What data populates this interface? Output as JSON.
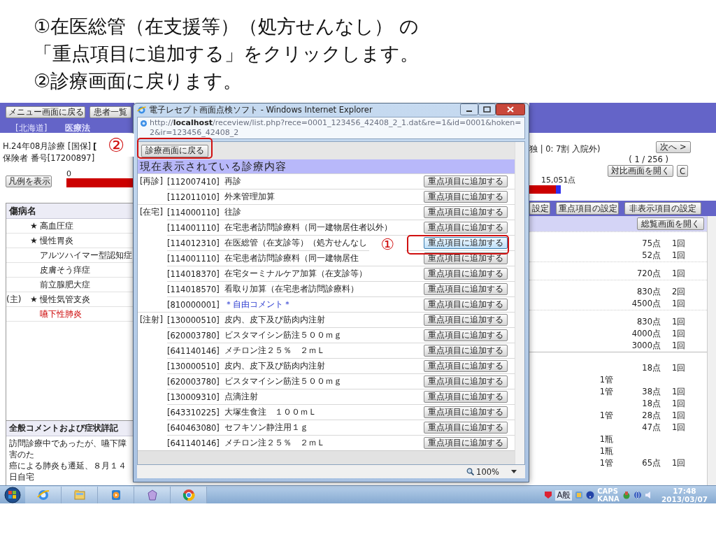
{
  "slide": {
    "instructions": [
      "①在医総管（在支援等）（処方せんなし） の",
      "「重点項目に追加する」をクリックします。",
      "②診療画面に戻ります。"
    ]
  },
  "main_app": {
    "nav_buttons": [
      "メニュー画面に戻る",
      "患者一覧"
    ],
    "prefecture": "[北海道]",
    "facility": "医療法",
    "claim_line": "H.24年08月診療 [国保]",
    "bracket": "[",
    "insurer": "保険者 番号[17200897]",
    "legend_button": "凡例を表示",
    "bar_min": "0",
    "insurance_type": "独 | 0: 7割 入院外)",
    "next_button": "次へ >",
    "page": "( 1 / 256 )",
    "compare_button": "対比画面を開く",
    "c_button": "C",
    "bar_total": "15,051点",
    "setting_tabs": [
      "設定",
      "重点項目の設定",
      "非表示項目の設定"
    ],
    "overview_button": "総覧画面を開く",
    "diseases": {
      "header": "傷病名",
      "items": [
        {
          "mark": "★",
          "name": "高血圧症",
          "kind": "normal"
        },
        {
          "mark": "★",
          "name": "慢性胃炎",
          "kind": "normal"
        },
        {
          "name": "アルツハイマー型認知症",
          "kind": "normal"
        },
        {
          "name": "皮膚そう痒症",
          "kind": "normal"
        },
        {
          "name": "前立腺肥大症",
          "kind": "normal"
        },
        {
          "prefix": "(主)",
          "mark": "★",
          "name": "慢性気管支炎",
          "kind": "normal"
        },
        {
          "name": "嚥下性肺炎",
          "kind": "alert"
        }
      ]
    },
    "points_groups": [
      [
        {
          "points": "75点",
          "count": "1回"
        },
        {
          "points": "52点",
          "count": "1回"
        }
      ],
      [
        {
          "points": "720点",
          "count": "1回"
        }
      ],
      [
        {
          "points": "830点",
          "count": "2回"
        },
        {
          "points": "4500点",
          "count": "1回"
        }
      ],
      [
        {
          "points": "830点",
          "count": "1回"
        },
        {
          "points": "4000点",
          "count": "1回"
        },
        {
          "points": "3000点",
          "count": "1回"
        }
      ],
      [
        {
          "points": "18点",
          "count": "1回"
        },
        {
          "unit": "1管"
        },
        {
          "unit": "1管",
          "points": "38点",
          "count": "1回"
        },
        {
          "points": "18点",
          "count": "1回"
        },
        {
          "unit": "1管",
          "points": "28点",
          "count": "1回"
        },
        {
          "points": "47点",
          "count": "1回"
        },
        {
          "unit": "1瓶"
        },
        {
          "unit": "1瓶"
        },
        {
          "unit": "1管",
          "points": "65点",
          "count": "1回"
        }
      ]
    ],
    "comment": {
      "header": "全般コメントおよび症状詳記",
      "lines": [
        "訪問診療中であったが、嚥下障害のた",
        "癌による肺炎も遷延、８月１４日自宅"
      ]
    }
  },
  "browser": {
    "title": "電子レセプト画面点検ソフト - Windows Internet Explorer",
    "url": "http://**localhost**/receview/list.php?rece=0001_123456_42408_2_1.dat&re=1&id=0001&hoken=2&ir=123456_42408_2",
    "back_button": "診療画面に戻る",
    "section_title": "現在表示されている診療内容",
    "rows": [
      {
        "category": "[再診]",
        "code": "[112007410]",
        "name": "再診",
        "kind": "item",
        "button": "重点項目に追加する",
        "highlighted": false
      },
      {
        "code": "[112011010]",
        "name": "外来管理加算",
        "kind": "item",
        "button": "重点項目に追加する",
        "highlighted": false
      },
      {
        "category": "[在宅]",
        "code": "[114000110]",
        "name": "往診",
        "kind": "item",
        "button": "重点項目に追加する",
        "highlighted": false
      },
      {
        "code": "[114001110]",
        "name": "在宅患者訪問診療料（同一建物居住者以外）",
        "kind": "item",
        "button": "重点項目に追加する",
        "highlighted": false
      },
      {
        "code": "[114012310]",
        "name": "在医総管（在支診等）（処方せんなし",
        "kind": "item",
        "button": "重点項目に追加する",
        "highlighted": true
      },
      {
        "code": "[114001110]",
        "name": "在宅患者訪問診療料（同一建物居住",
        "kind": "item",
        "button": "重点項目に追加する",
        "highlighted": false
      },
      {
        "code": "[114018370]",
        "name": "在宅ターミナルケア加算（在支診等）",
        "kind": "item",
        "button": "重点項目に追加する",
        "highlighted": false
      },
      {
        "code": "[114018570]",
        "name": "看取り加算（在宅患者訪問診療料）",
        "kind": "item",
        "button": "重点項目に追加する",
        "highlighted": false
      },
      {
        "code": "[810000001]",
        "name": "＊自由コメント＊",
        "kind": "comment",
        "button": "重点項目に追加する",
        "highlighted": false
      },
      {
        "category": "[注射]",
        "code": "[130000510]",
        "name": "皮内、皮下及び筋肉内注射",
        "kind": "item",
        "button": "重点項目に追加する",
        "highlighted": false
      },
      {
        "code": "[620003780]",
        "name": "ビスタマイシン筋注５００ｍｇ",
        "kind": "item",
        "button": "重点項目に追加する",
        "highlighted": false
      },
      {
        "code": "[641140146]",
        "name": "メチロン注２５％　２ｍＬ",
        "kind": "item",
        "button": "重点項目に追加する",
        "highlighted": false
      },
      {
        "code": "[130000510]",
        "name": "皮内、皮下及び筋肉内注射",
        "kind": "item",
        "button": "重点項目に追加する",
        "highlighted": false
      },
      {
        "code": "[620003780]",
        "name": "ビスタマイシン筋注５００ｍｇ",
        "kind": "item",
        "button": "重点項目に追加する",
        "highlighted": false
      },
      {
        "code": "[130009310]",
        "name": "点滴注射",
        "kind": "item",
        "button": "重点項目に追加する",
        "highlighted": false
      },
      {
        "code": "[643310225]",
        "name": "大塚生食注　１００ｍＬ",
        "kind": "item",
        "button": "重点項目に追加する",
        "highlighted": false
      },
      {
        "code": "[640463080]",
        "name": "セフキソン静注用１ｇ",
        "kind": "item",
        "button": "重点項目に追加する",
        "highlighted": false
      },
      {
        "code": "[641140146]",
        "name": "メチロン注２５％　２ｍＬ",
        "kind": "item",
        "button": "重点項目に追加する",
        "highlighted": false
      }
    ],
    "zoom": "100%"
  },
  "callouts": [
    {
      "label": "②"
    },
    {
      "label": "①"
    }
  ],
  "taskbar": {
    "ime": "A般",
    "tray_labels": [
      "CAPS",
      "KANA"
    ],
    "time": "17:48",
    "date": "2013/03/07"
  }
}
